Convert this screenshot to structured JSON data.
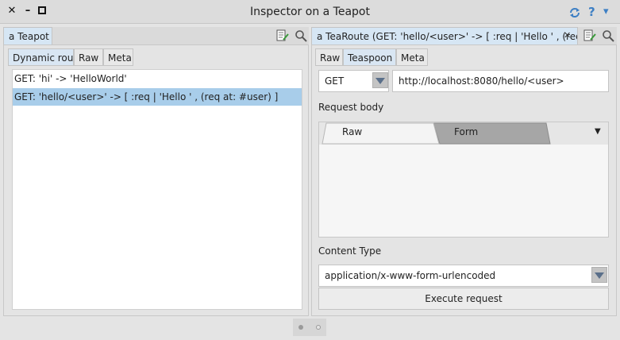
{
  "window": {
    "title": "Inspector on a Teapot",
    "close_glyph": "✕",
    "minimize_glyph": "–",
    "help_glyph": "?",
    "menu_glyph": "▾"
  },
  "left_pane": {
    "tab_label": "a Teapot",
    "subtabs": [
      "Dynamic rou...",
      "Raw",
      "Meta"
    ],
    "routes": [
      "GET: 'hi' -> 'HelloWorld'",
      "GET: 'hello/<user>' -> [ :req | 'Hello ' , (req at: #user) ]"
    ]
  },
  "right_pane": {
    "tab_label": "a TeaRoute (GET: 'hello/<user>' -> [ :req | 'Hello ' , (req a...",
    "tab_close_glyph": "✕",
    "subtabs": [
      "Raw",
      "Teaspoon",
      "Meta"
    ],
    "method": "GET",
    "url": "http://localhost:8080/hello/<user>",
    "request_body_label": "Request body",
    "body_tabs": [
      "Raw",
      "Form"
    ],
    "body_dropdown_glyph": "▼",
    "content_type_label": "Content Type",
    "content_type": "application/x-www-form-urlencoded",
    "execute_label": "Execute request"
  },
  "colors": {
    "selection": "#a8cdea",
    "active_tab": "#d9e6f3",
    "accent_icon": "#3d7fc4"
  }
}
